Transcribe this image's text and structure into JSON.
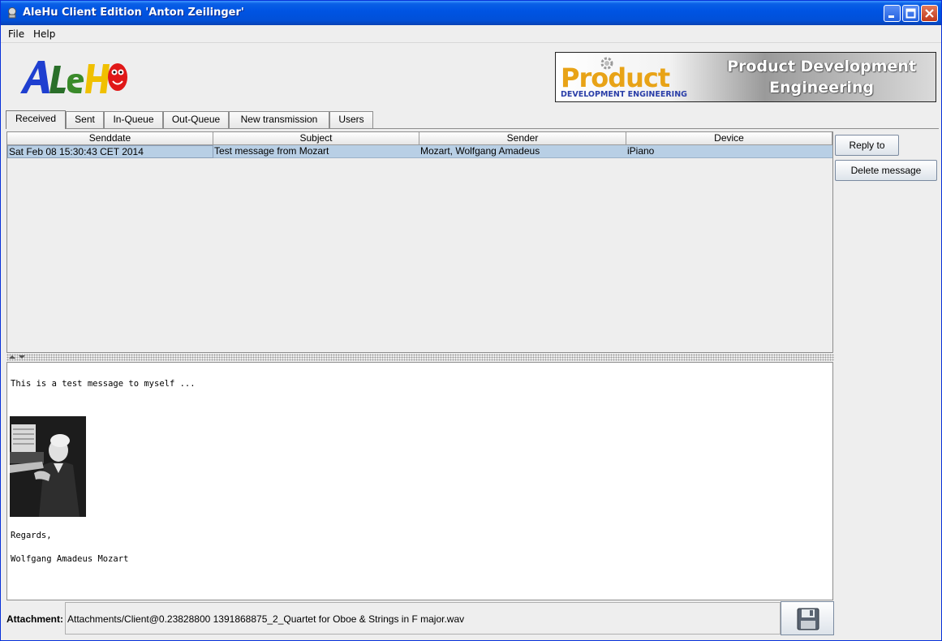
{
  "window": {
    "title": "AleHu Client Edition 'Anton Zeilinger'"
  },
  "menu": {
    "items": [
      "File",
      "Help"
    ]
  },
  "banner": {
    "word": "Product",
    "sub": "DEVELOPMENT ENGINEERING",
    "right_line1": "Product Development",
    "right_line2": "Engineering",
    "word_color": "#e8a317",
    "sub_color": "#2a3ea8"
  },
  "tabs": [
    {
      "label": "Received",
      "active": true
    },
    {
      "label": "Sent"
    },
    {
      "label": "In-Queue"
    },
    {
      "label": "Out-Queue"
    },
    {
      "label": "New transmission"
    },
    {
      "label": "Users"
    }
  ],
  "table": {
    "columns": [
      "Senddate",
      "Subject",
      "Sender",
      "Device"
    ],
    "rows": [
      [
        "Sat Feb 08 15:30:43 CET 2014",
        "Test message from Mozart",
        "Mozart, Wolfgang Amadeus",
        "iPiano"
      ]
    ],
    "selected_color": "#b8cfe5"
  },
  "actions": {
    "reply_label": "Reply to",
    "delete_label": "Delete message"
  },
  "message": {
    "line1": "This is a test message to myself ...",
    "regards": "Regards,",
    "signature": "Wolfgang Amadeus Mozart"
  },
  "attachment": {
    "label": "Attachment:",
    "value": "Attachments/Client@0.23828800 1391868875_2_Quartet for Oboe & Strings in F major.wav"
  }
}
